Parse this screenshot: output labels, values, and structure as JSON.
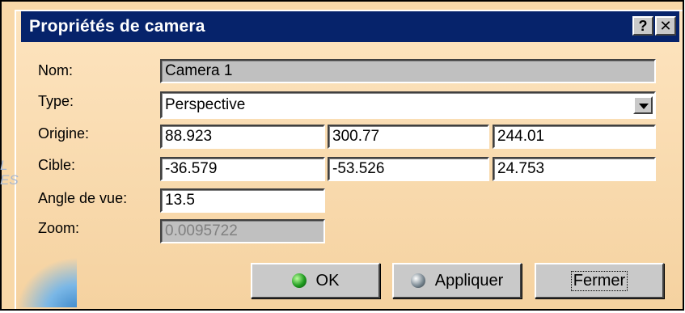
{
  "window": {
    "title": "Propriétés de camera",
    "help_label": "?",
    "close_label": "✕"
  },
  "form": {
    "name_label": "Nom:",
    "name_value": "Camera  1",
    "type_label": "Type:",
    "type_value": "Perspective",
    "origin_label": "Origine:",
    "origin_values": [
      "88.923",
      "300.77",
      "244.01"
    ],
    "target_label": "Cible:",
    "target_values": [
      "-36.579",
      "-53.526",
      "24.753"
    ],
    "angle_label": "Angle de vue:",
    "angle_value": "13.5",
    "zoom_label": "Zoom:",
    "zoom_value": "0.0095722"
  },
  "buttons": {
    "ok_label": "OK",
    "apply_label": "Appliquer",
    "close_label": "Fermer"
  },
  "background": {
    "ghost_text_1": "L",
    "ghost_text_2": "ES"
  },
  "colors": {
    "titlebar": "#06236b",
    "dialog_bg": "#f8d8a8",
    "field_readonly": "#c0c0c0",
    "callout": "#ffff00"
  }
}
